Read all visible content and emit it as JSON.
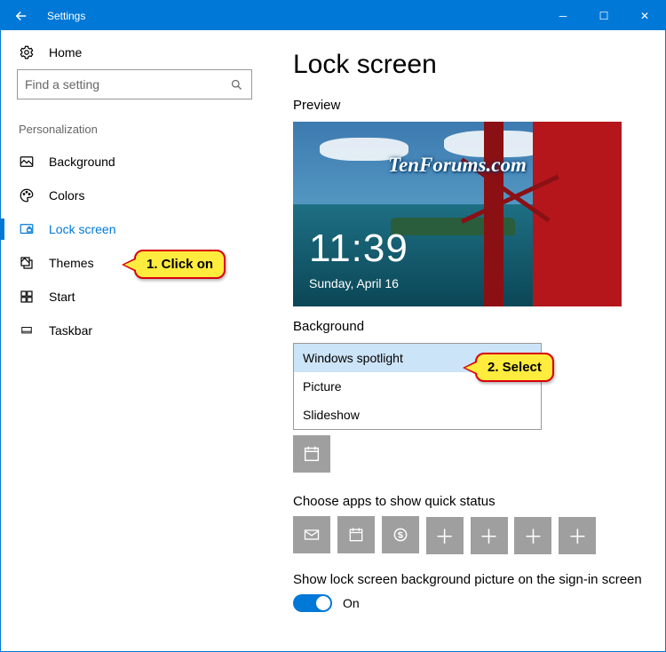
{
  "window": {
    "title": "Settings"
  },
  "sidebar": {
    "home": "Home",
    "search_placeholder": "Find a setting",
    "section": "Personalization",
    "items": [
      {
        "label": "Background"
      },
      {
        "label": "Colors"
      },
      {
        "label": "Lock screen"
      },
      {
        "label": "Themes"
      },
      {
        "label": "Start"
      },
      {
        "label": "Taskbar"
      }
    ]
  },
  "main": {
    "heading": "Lock screen",
    "preview_label": "Preview",
    "watermark": "TenForums.com",
    "clock": "11:39",
    "date": "Sunday, April 16",
    "background_label": "Background",
    "dropdown": {
      "options": [
        "Windows spotlight",
        "Picture",
        "Slideshow"
      ],
      "selected_index": 0
    },
    "quick_status_label": "Choose apps to show quick status",
    "show_on_signin_label": "Show lock screen background picture on the sign-in screen",
    "toggle_text": "On"
  },
  "callouts": {
    "step1": "1. Click on",
    "step2": "2. Select"
  }
}
